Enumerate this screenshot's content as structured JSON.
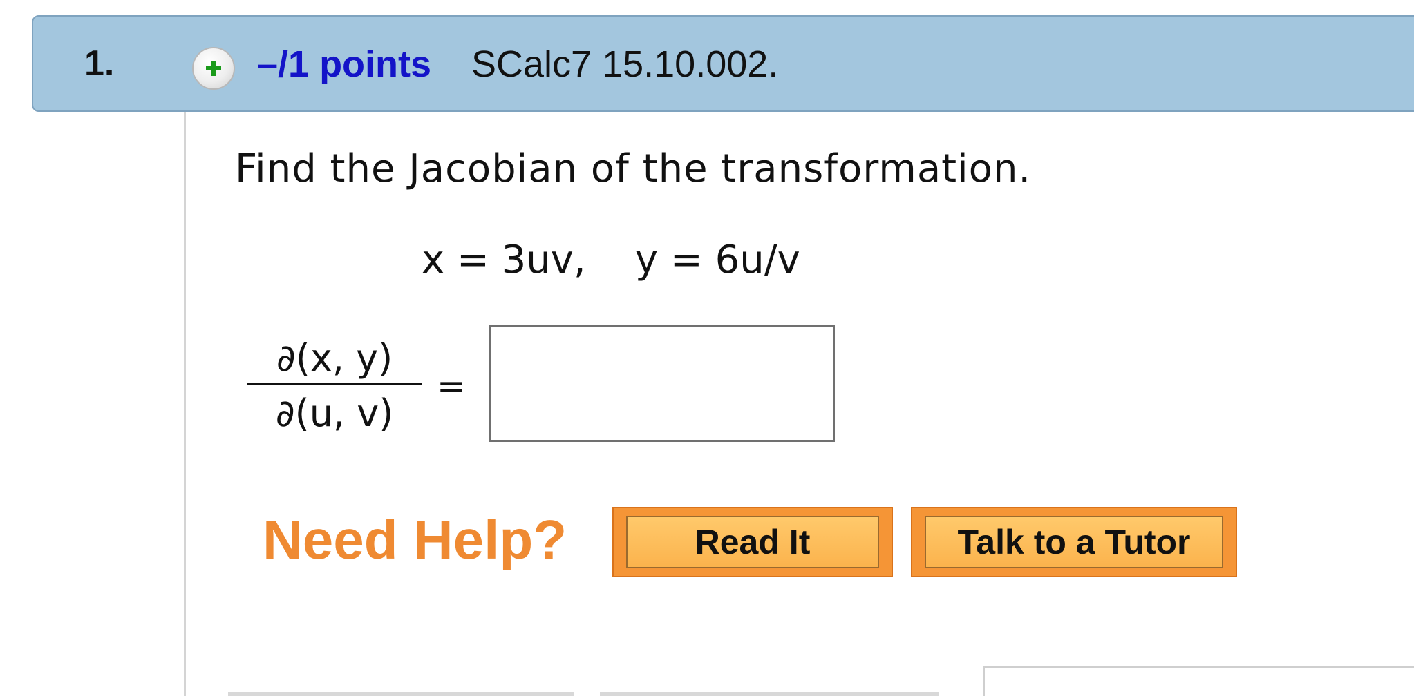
{
  "question": {
    "number": "1.",
    "points": "–/1 points",
    "id": "SCalc7 15.10.002.",
    "expand_icon": "plus-icon",
    "expand_icon_color": "#1a9a1a"
  },
  "content": {
    "prompt": "Find the Jacobian of the transformation.",
    "equation": "x = 3uv,    y = 6u/v",
    "fraction_numerator": "∂(x, y)",
    "fraction_denominator": "∂(u, v)",
    "equals": "=",
    "answer_value": ""
  },
  "help": {
    "label": "Need Help?",
    "read_it": "Read It",
    "talk_to_tutor": "Talk to a Tutor"
  },
  "colors": {
    "header_bg": "#a3c6de",
    "points_link": "#1414c8",
    "need_help": "#ef8a32",
    "button_orange": "#f59536"
  }
}
